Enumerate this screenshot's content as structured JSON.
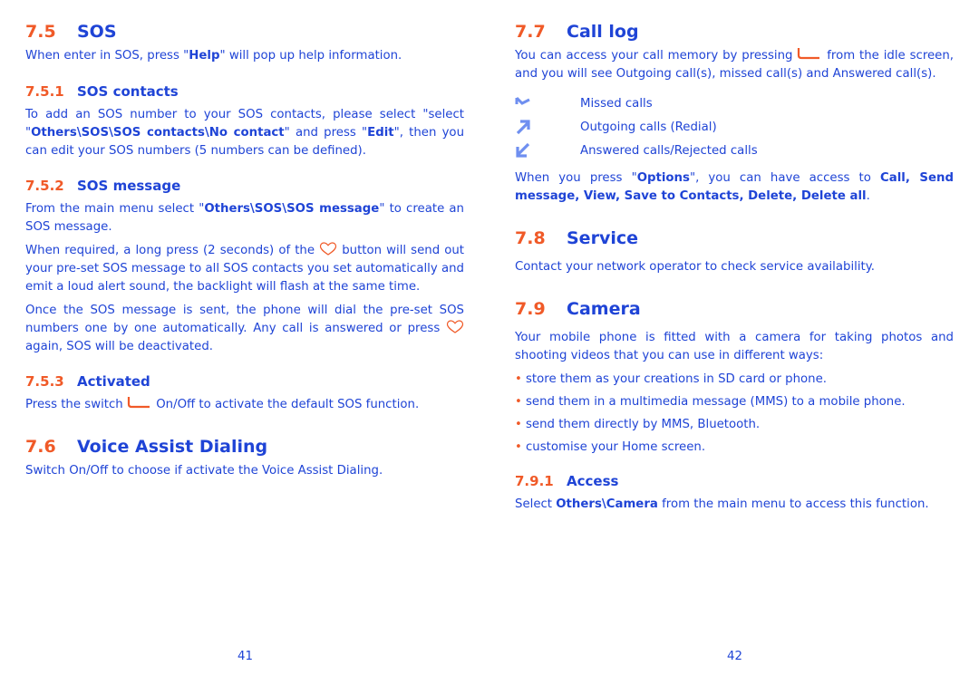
{
  "left": {
    "s75": {
      "num": "7.5",
      "title": "SOS",
      "p1": {
        "a": "When enter in SOS, press \"",
        "b": "Help",
        "c": "\" will pop up help information."
      }
    },
    "s751": {
      "num": "7.5.1",
      "title": "SOS contacts",
      "p1": {
        "a": "To add an SOS number to your SOS contacts, please select \"select \"",
        "b": "Others\\SOS\\SOS contacts\\No contact",
        "c": "\" and press \"",
        "d": "Edit",
        "e": "\", then you can edit your SOS numbers (5 numbers can be defined)."
      }
    },
    "s752": {
      "num": "7.5.2",
      "title": "SOS message",
      "p1": {
        "a": "From the main menu select \"",
        "b": "Others\\SOS\\SOS message",
        "c": "\" to create an SOS message."
      },
      "p2": {
        "a": "When required, a long press (2 seconds) of the",
        "b": "button will send out your pre-set SOS message to all SOS contacts you set automatically and emit a loud alert sound, the backlight will flash at the same time."
      },
      "p3": {
        "a": "Once the SOS message is sent, the phone will dial the pre-set SOS numbers one by one automatically. Any call is answered or press",
        "b": "again, SOS will be deactivated."
      }
    },
    "s753": {
      "num": "7.5.3",
      "title": "Activated",
      "p1": {
        "a": "Press the switch",
        "b": "On/Off to activate the default SOS function."
      }
    },
    "s76": {
      "num": "7.6",
      "title": "Voice Assist Dialing",
      "p1": "Switch On/Off to choose if activate the Voice Assist Dialing."
    },
    "page_number": "41"
  },
  "right": {
    "s77": {
      "num": "7.7",
      "title": "Call log",
      "p1": {
        "a": "You can access your call memory by pressing",
        "b": "from the idle screen, and you will see Outgoing call(s), missed call(s) and Answered call(s)."
      },
      "call_types": [
        {
          "icon": "missed-call-icon",
          "label": "Missed calls"
        },
        {
          "icon": "outgoing-call-icon",
          "label": "Outgoing calls (Redial)"
        },
        {
          "icon": "answered-call-icon",
          "label": "Answered calls/Rejected calls"
        }
      ],
      "p2": {
        "a": "When you press \"",
        "b": "Options",
        "c": "\", you can have access to ",
        "d": "Call, Send message, View, Save to Contacts, Delete, Delete all",
        "e": "."
      }
    },
    "s78": {
      "num": "7.8",
      "title": "Service",
      "p1": "Contact your network operator to check service availability."
    },
    "s79": {
      "num": "7.9",
      "title": "Camera",
      "p1": "Your mobile phone is fitted with a camera for taking photos and shooting videos that you can use in different ways:",
      "bullets": [
        "store them as your creations in SD card or phone.",
        "send them in a multimedia message (MMS) to a mobile phone.",
        "send them directly by MMS, Bluetooth.",
        "customise your Home screen."
      ]
    },
    "s791": {
      "num": "7.9.1",
      "title": "Access",
      "p1": {
        "a": "Select ",
        "b": "Others\\Camera",
        "c": " from the main menu to access this function."
      }
    },
    "page_number": "42"
  },
  "colors": {
    "text": "#1f44d6",
    "accent": "#f05a28",
    "icon": "#6f8ff0"
  }
}
